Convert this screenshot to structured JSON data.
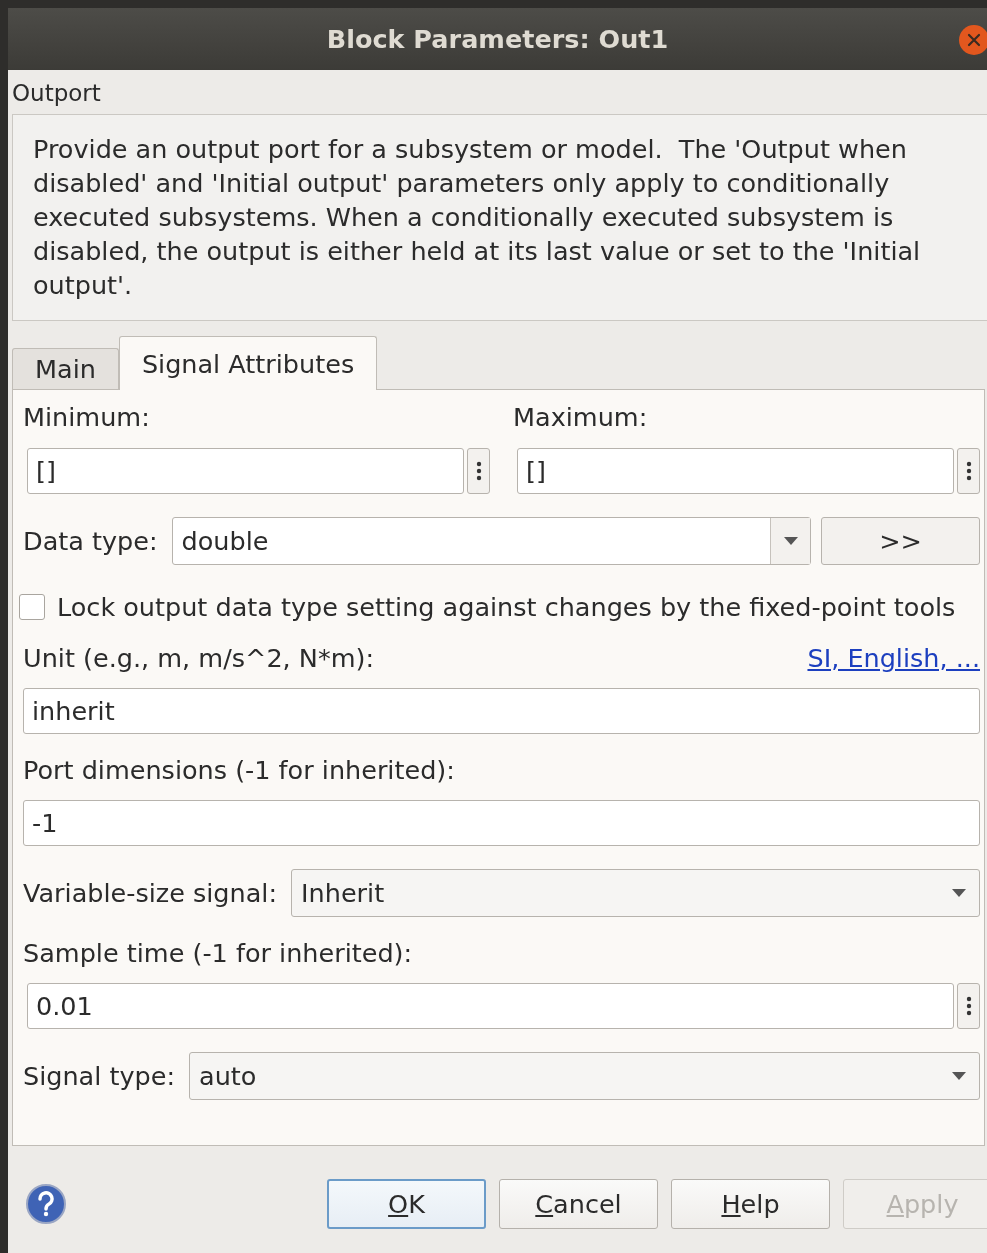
{
  "window": {
    "title": "Block Parameters: Out1",
    "close_button": true
  },
  "block_type": "Outport",
  "description": "Provide an output port for a subsystem or model.  The 'Output when disabled' and 'Initial output' parameters only apply to conditionally executed subsystems. When a conditionally executed subsystem is disabled, the output is either held at its last value or set to the 'Initial output'.",
  "tabs": [
    {
      "label": "Main",
      "selected": false
    },
    {
      "label": "Signal Attributes",
      "selected": true
    }
  ],
  "parameters": [
    {
      "kind": "pair",
      "items": [
        {
          "label": "Minimum:",
          "value": "[]"
        },
        {
          "label": "Maximum:",
          "value": "[]"
        }
      ]
    },
    {
      "kind": "select",
      "label": "Data type:",
      "value": "double",
      "assistant_button": ">>"
    },
    {
      "kind": "checkbox",
      "label": "Lock output data type setting against changes by the fixed-point tools",
      "checked": false
    },
    {
      "kind": "text",
      "label": "Unit (e.g., m, m/s^2, N*m):",
      "link": "SI, English, ...",
      "value": "inherit"
    },
    {
      "kind": "text",
      "label": "Port dimensions (-1 for inherited):",
      "value": "-1"
    },
    {
      "kind": "select",
      "label": "Variable-size signal:",
      "value": "Inherit"
    },
    {
      "kind": "text",
      "label": "Sample time (-1 for inherited):",
      "value": "0.01",
      "menu_button": true
    },
    {
      "kind": "select",
      "label": "Signal type:",
      "value": "auto"
    }
  ],
  "buttons": [
    {
      "label": "OK",
      "default": true,
      "disabled": false,
      "mnemonic_underlined": true
    },
    {
      "label": "Cancel",
      "default": false,
      "disabled": false,
      "mnemonic_underlined": true
    },
    {
      "label": "Help",
      "default": false,
      "disabled": false,
      "mnemonic_underlined": true
    },
    {
      "label": "Apply",
      "default": false,
      "disabled": true,
      "mnemonic_underlined": true
    }
  ]
}
